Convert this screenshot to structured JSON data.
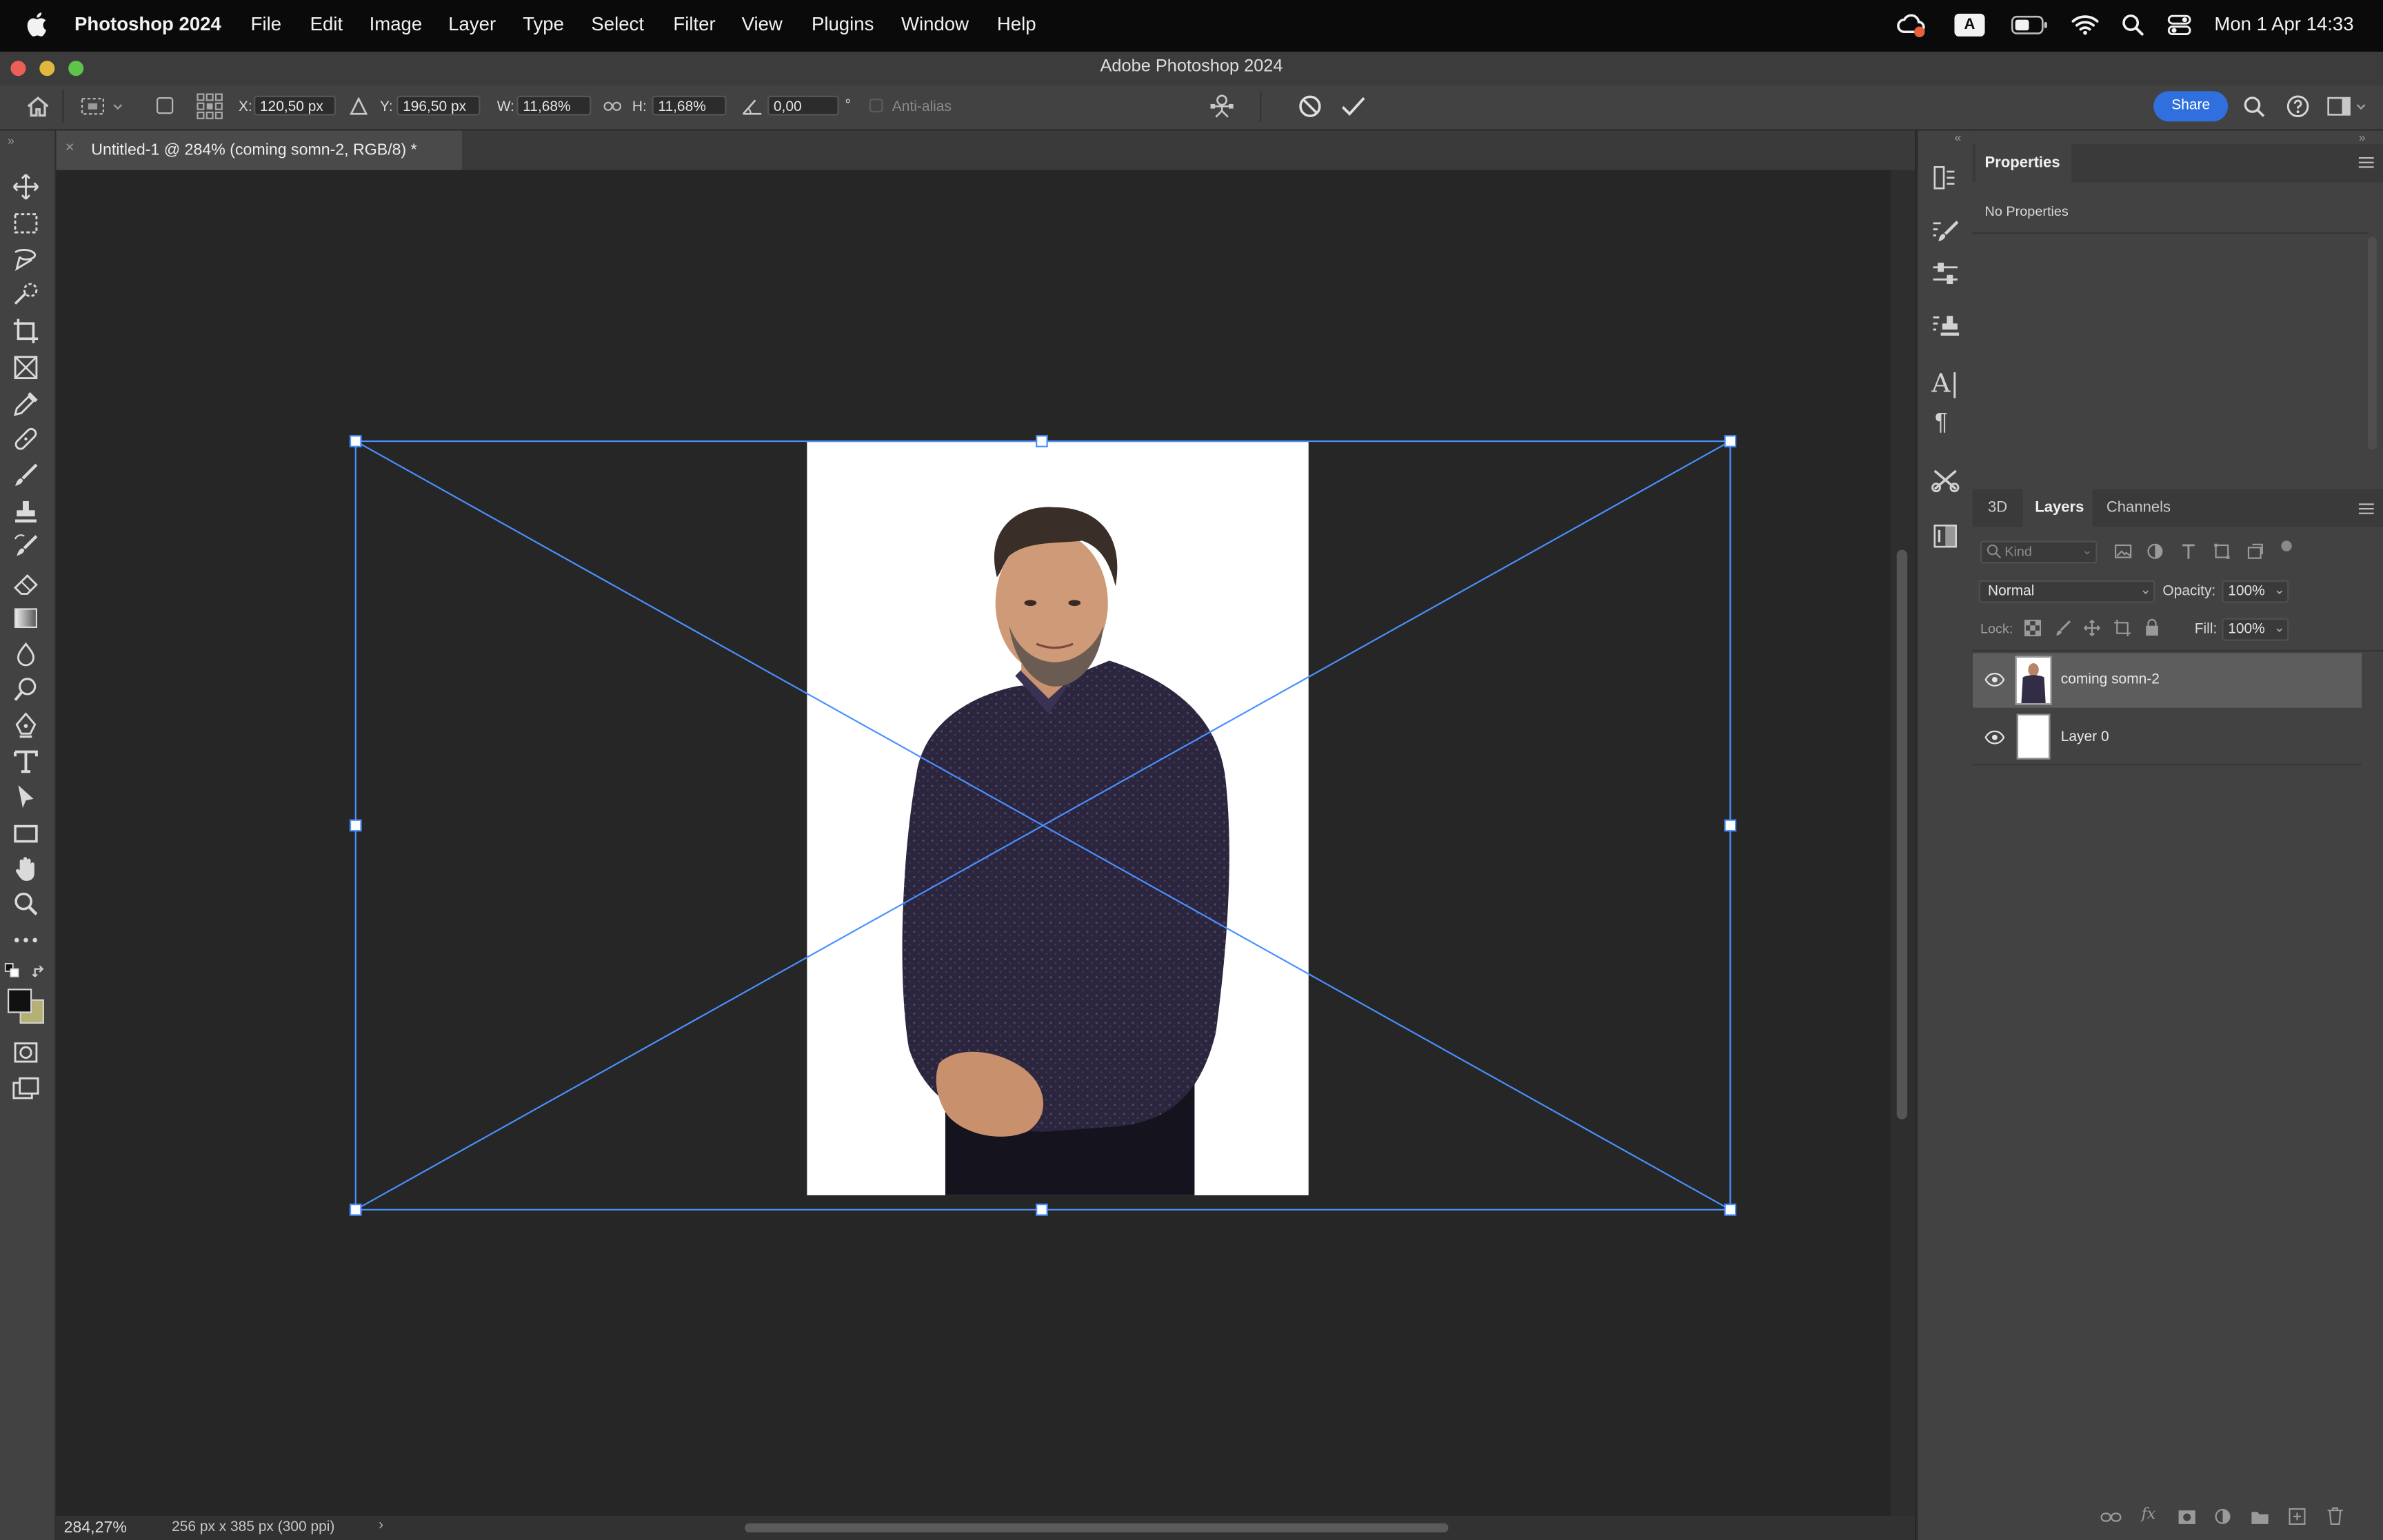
{
  "menubar": {
    "app_name": "Photoshop 2024",
    "items": [
      "File",
      "Edit",
      "Image",
      "Layer",
      "Type",
      "Select",
      "Filter",
      "View",
      "Plugins",
      "Window",
      "Help"
    ],
    "status_icons": [
      "creative-cloud-icon",
      "input-source-icon",
      "battery-icon",
      "wifi-icon",
      "spotlight-icon",
      "control-center-icon"
    ],
    "input_source": "A",
    "clock": "Mon 1 Apr  14:33"
  },
  "window": {
    "title": "Adobe Photoshop 2024"
  },
  "options_bar": {
    "x_label": "X:",
    "x_value": "120,50 px",
    "y_label": "Y:",
    "y_value": "196,50 px",
    "w_label": "W:",
    "w_value": "11,68%",
    "h_label": "H:",
    "h_value": "11,68%",
    "angle_value": "0,00",
    "angle_unit": "°",
    "anti_alias_label": "Anti-alias",
    "share_label": "Share"
  },
  "document": {
    "tab_title": "Untitled-1 @ 284% (coming somn-2, RGB/8) *",
    "zoom": "284,27%",
    "doc_info": "256 px x 385 px (300 ppi)"
  },
  "properties_panel": {
    "tab": "Properties",
    "message": "No Properties"
  },
  "layers_panel": {
    "tabs": [
      "3D",
      "Layers",
      "Channels"
    ],
    "active_tab": "Layers",
    "filter_placeholder": "Kind",
    "blend_mode": "Normal",
    "opacity_label": "Opacity:",
    "opacity_value": "100%",
    "lock_label": "Lock:",
    "fill_label": "Fill:",
    "fill_value": "100%",
    "layers": [
      {
        "name": "coming somn-2",
        "visible": true,
        "selected": true
      },
      {
        "name": "Layer 0",
        "visible": true,
        "selected": false
      }
    ]
  },
  "colors": {
    "accent": "#2f6fde",
    "transform_box": "#4a90ff",
    "foreground_swatch": "#111111",
    "background_swatch": "#b5b074"
  }
}
